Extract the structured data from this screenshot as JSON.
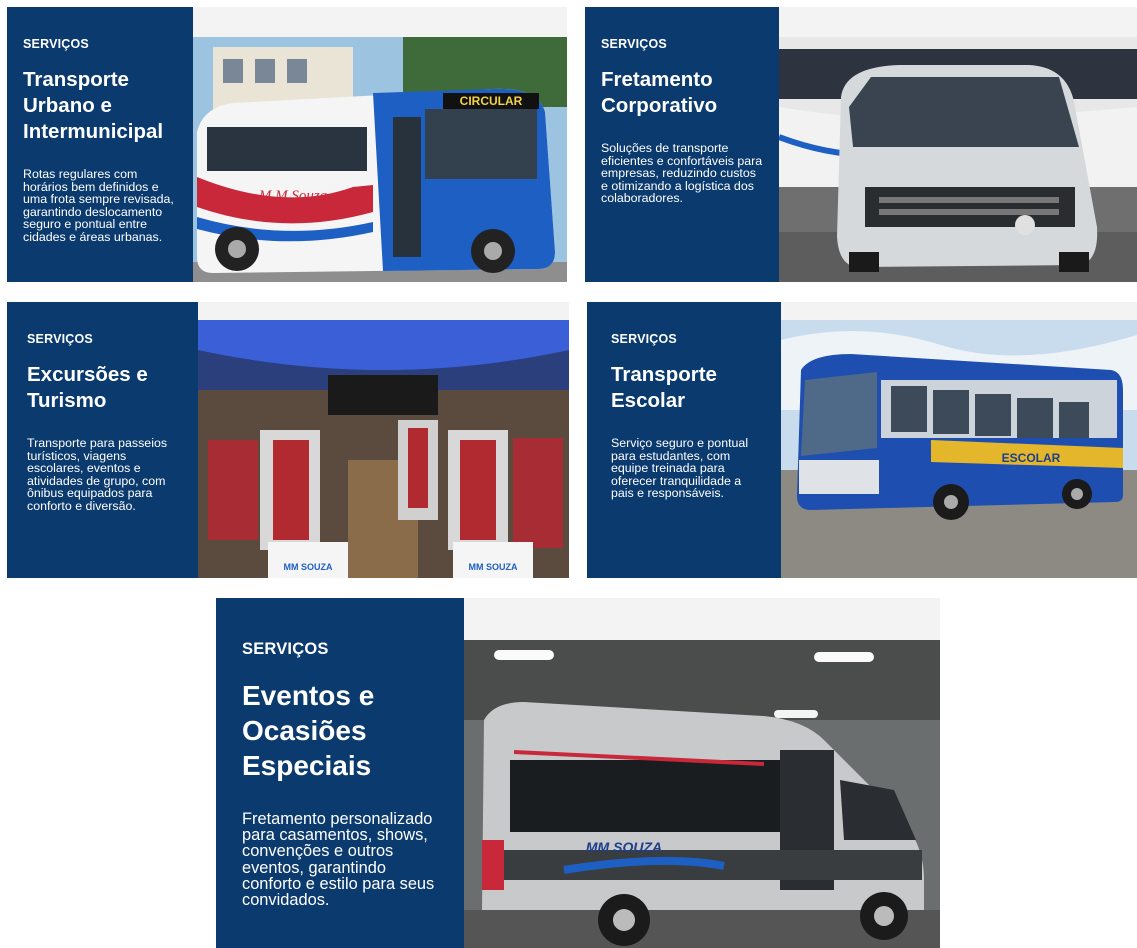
{
  "cards": [
    {
      "eyebrow": "SERVIÇOS",
      "title": "Transporte Urbano e Intermunicipal",
      "description": "Rotas regulares com horários bem definidos e uma frota sempre revisada, garantindo deslocamento seguro e pontual entre cidades e áreas urbanas.",
      "photo_bus_sign": "CIRCULAR",
      "photo_bus_brand": "M M Souza"
    },
    {
      "eyebrow": "SERVIÇOS",
      "title": "Fretamento Corporativo",
      "description": "Soluções de transporte eficientes e confortáveis para empresas, reduzindo custos e otimizando a logística dos colaboradores."
    },
    {
      "eyebrow": "SERVIÇOS",
      "title": "Excursões e Turismo",
      "description": "Transporte para passeios turísticos, viagens escolares, eventos e atividades de grupo, com ônibus equipados para conforto e diversão.",
      "photo_seat_brand": "MM SOUZA"
    },
    {
      "eyebrow": "SERVIÇOS",
      "title": "Transporte Escolar",
      "description": "Serviço seguro e pontual para estudantes, com equipe treinada para oferecer tranquilidade a pais e responsáveis.",
      "photo_bus_sign": "ESCOLAR"
    },
    {
      "eyebrow": "SERVIÇOS",
      "title": "Eventos e Ocasiões Especiais",
      "description": "Fretamento personalizado para casamentos, shows, convenções e outros eventos, garantindo conforto e estilo para seus convidados.",
      "photo_van_brand": "MM SOUZA"
    }
  ],
  "colors": {
    "panel": "#0b3a6e",
    "card_background": "#f3f3f3",
    "bus_blue": "#1e5fc4",
    "bus_red": "#c8283a",
    "school_yellow": "#e3b62c"
  }
}
